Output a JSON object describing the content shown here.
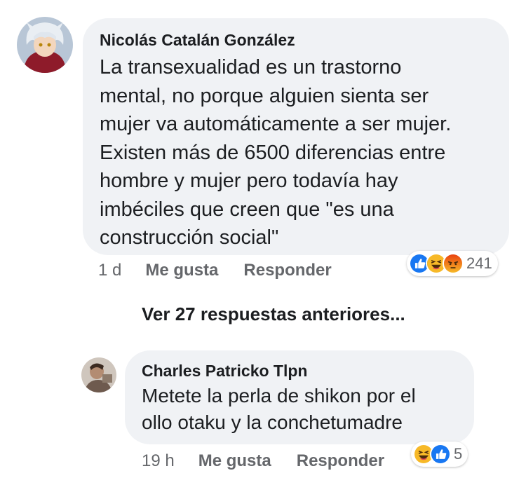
{
  "comment": {
    "author": "Nicolás Catalán González",
    "lines": [
      "La transexualidad es un trastorno",
      "mental, no porque alguien sienta ser",
      "mujer va automáticamente a ser mujer.",
      "Existen más de 6500 diferencias entre",
      "hombre y mujer pero todavía hay",
      "imbéciles que creen que \"es una",
      "construcción social\""
    ],
    "time": "1 d",
    "like_label": "Me gusta",
    "reply_label": "Responder",
    "reactions": [
      "like-icon",
      "haha-icon",
      "angry-icon"
    ],
    "reaction_count": "241"
  },
  "view_more": "Ver 27 respuestas anteriores...",
  "reply": {
    "author": "Charles Patricko Tlpn",
    "lines": [
      "Metete la perla de shikon por el",
      "ollo otaku y la conchetumadre"
    ],
    "time": "19 h",
    "like_label": "Me gusta",
    "reply_label": "Responder",
    "reactions": [
      "haha-icon",
      "like-icon"
    ],
    "reaction_count": "5"
  },
  "colors": {
    "bubble": "#f0f2f5",
    "meta": "#65676b",
    "like_blue": "#1877f2",
    "haha_yellow": "#f7b928",
    "angry_red": "#e9710f"
  }
}
